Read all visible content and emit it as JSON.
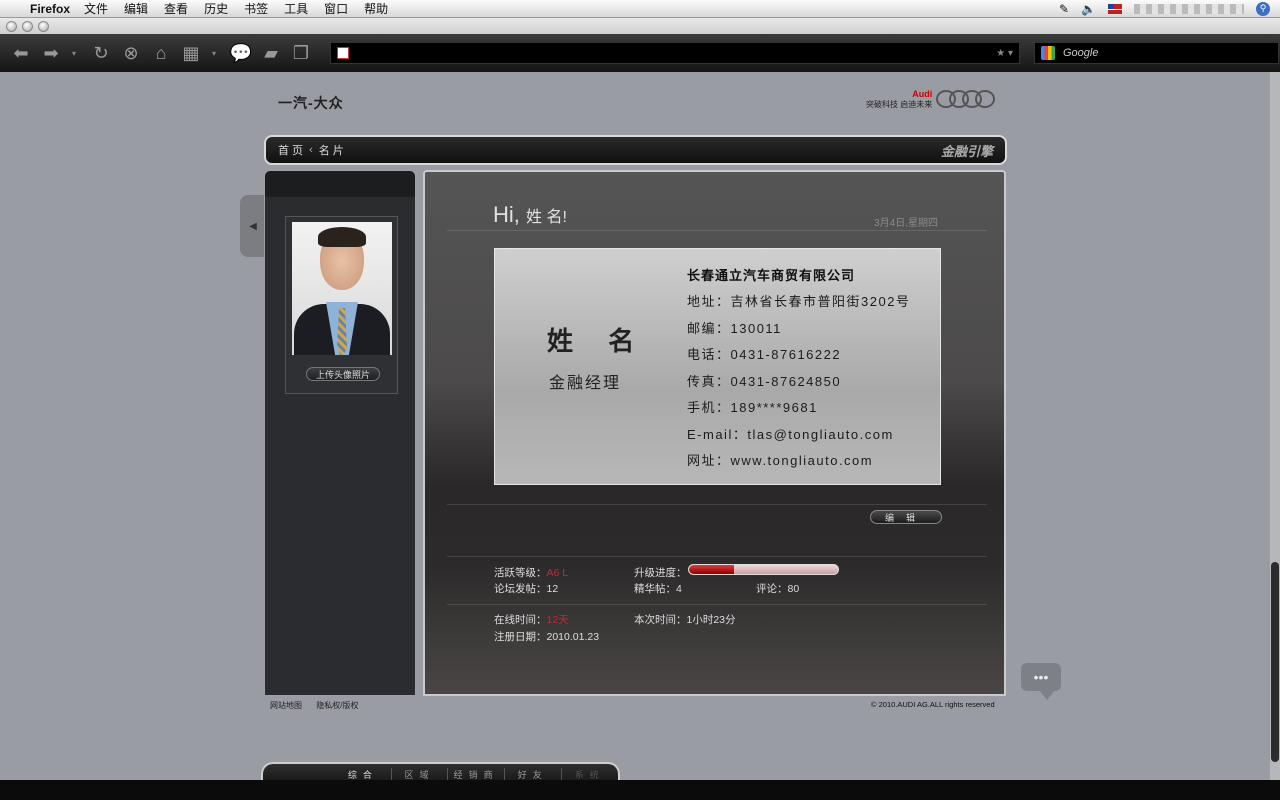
{
  "menubar": {
    "app_name": "Firefox",
    "menus": [
      "文件",
      "编辑",
      "查看",
      "历史",
      "书签",
      "工具",
      "窗口",
      "帮助"
    ]
  },
  "toolbar": {
    "search_placeholder": "Google"
  },
  "header": {
    "brand_left": "一汽-大众",
    "audi_label": "Audi",
    "slogan": "突破科技 启迪未来"
  },
  "breadcrumb": {
    "home": "首 页",
    "current": "名 片",
    "section_logo": "金融引擎"
  },
  "sidebar": {
    "upload_label": "上传头像照片"
  },
  "main": {
    "greeting_hi": "Hi,",
    "greeting_name": "姓 名!",
    "date": "3月4日,星期四",
    "card": {
      "name": "姓 名",
      "title": "金融经理",
      "company": "长春通立汽车商贸有限公司",
      "address": "地址：吉林省长春市普阳街3202号",
      "postcode": "邮编：130011",
      "phone": "电话：0431-87616222",
      "fax": "传真：0431-87624850",
      "mobile": "手机：189****9681",
      "email": "E-mail：tlas@tongliauto.com",
      "website": "网址：www.tongliauto.com"
    },
    "edit_label": "编辑",
    "stats": {
      "level_label": "活跃等级：",
      "level_value": "A6 L",
      "upgrade_label": "升级进度：",
      "upgrade_progress": 0.3,
      "posts_label": "论坛发帖：",
      "posts_value": "12",
      "featured_label": "精华帖：",
      "featured_value": "4",
      "comments_label": "评论：",
      "comments_value": "80",
      "online_label": "在线时间：",
      "online_value": "12天",
      "session_label": "本次时间：",
      "session_value": "1小时23分",
      "register_label": "注册日期：",
      "register_value": "2010.01.23"
    }
  },
  "footer": {
    "sitemap": "网站地图",
    "privacy": "隐私权/版权",
    "copyright": "© 2010.AUDI AG.ALL rights reserved"
  },
  "bottom_tabs": [
    "综合",
    "区域",
    "经销商",
    "好友",
    "系统"
  ]
}
